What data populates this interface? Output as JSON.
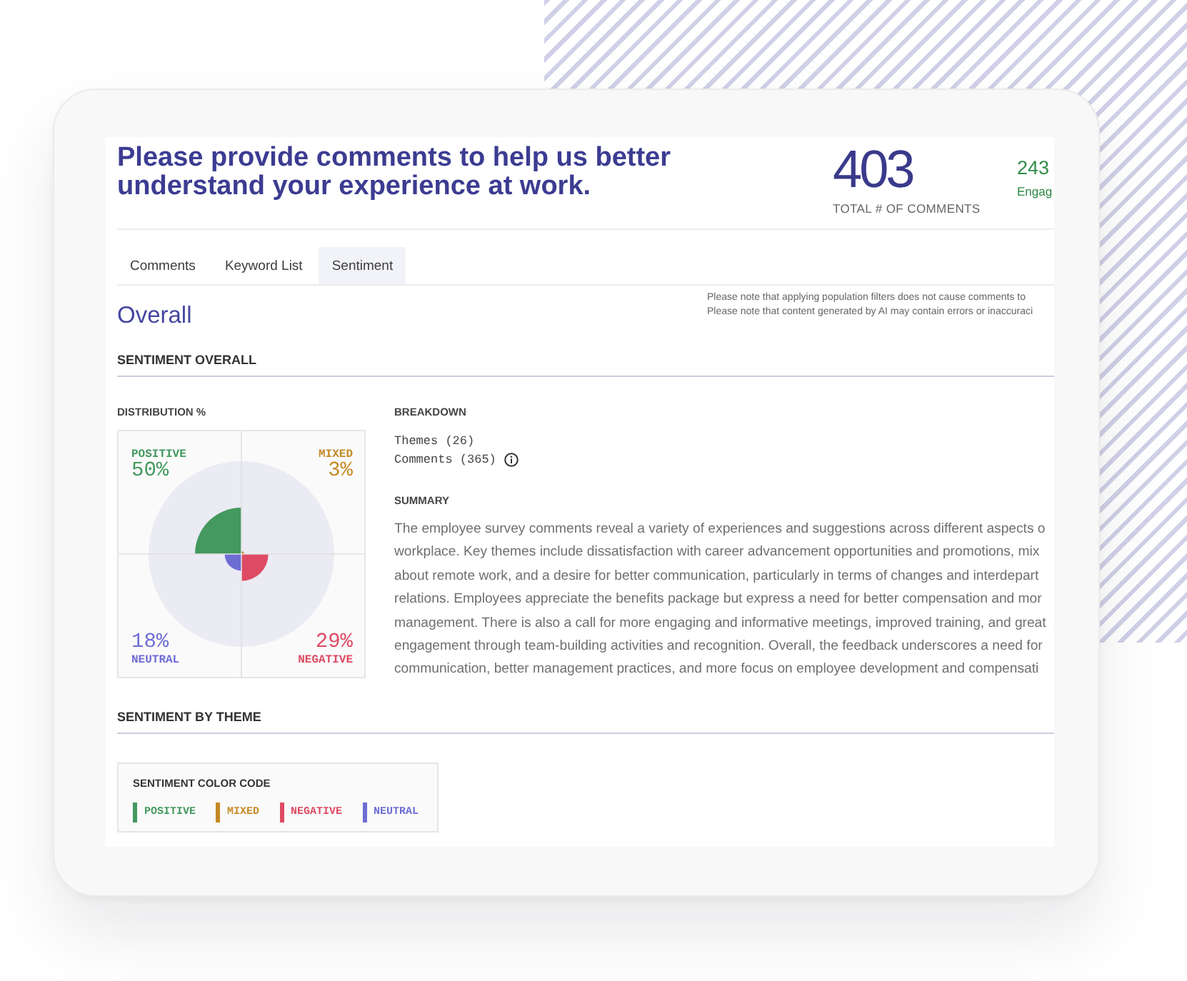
{
  "header": {
    "title": "Please provide comments to help us better understand your experience at work.",
    "stats": [
      {
        "kind": "total",
        "value": "403",
        "label": "TOTAL # OF COMMENTS",
        "color": "#3a3a8c"
      },
      {
        "kind": "partial",
        "value": "243",
        "label": "Engag",
        "color": "#2e8b47"
      }
    ]
  },
  "tabs": [
    {
      "label": "Comments",
      "selected": false
    },
    {
      "label": "Keyword List",
      "selected": false
    },
    {
      "label": "Sentiment",
      "selected": true
    }
  ],
  "page_title": "Overall",
  "notes": [
    "Please note that applying population filters does not cause comments to",
    "Please note that content generated by AI may contain errors or inaccuraci"
  ],
  "sentiment_overall": {
    "heading": "SENTIMENT OVERALL",
    "distribution": {
      "label": "DISTRIBUTION %",
      "items": [
        {
          "label": "POSITIVE",
          "percent": "50%",
          "level": 0.5,
          "color": "#43995f"
        },
        {
          "label": "MIXED",
          "percent": "3%",
          "level": 0.03,
          "color": "#c58a26"
        },
        {
          "label": "NEUTRAL",
          "percent": "18%",
          "level": 0.18,
          "color": "#6d6dd4"
        },
        {
          "label": "NEGATIVE",
          "percent": "29%",
          "level": 0.29,
          "color": "#de4a63"
        }
      ]
    },
    "breakdown": {
      "label": "BREAKDOWN",
      "items": [
        {
          "text": "Themes (26)",
          "info": false
        },
        {
          "text": "Comments (365)",
          "info": true
        }
      ]
    },
    "summary": {
      "label": "SUMMARY",
      "lines": [
        "The employee survey comments reveal a variety of experiences and suggestions across different aspects o",
        "workplace. Key themes include dissatisfaction with career advancement opportunities and promotions, mix",
        "about remote work, and a desire for better communication, particularly in terms of changes and interdepart",
        "relations. Employees appreciate the benefits package but express a need for better compensation and mor",
        "management. There is also a call for more engaging and informative meetings, improved training, and great",
        "engagement through team-building activities and recognition. Overall, the feedback underscores a need for",
        "communication, better management practices, and more focus on employee development and compensati"
      ]
    }
  },
  "sentiment_by_theme": {
    "heading": "SENTIMENT BY THEME",
    "legend": {
      "title": "SENTIMENT COLOR CODE",
      "items": [
        {
          "label": "POSITIVE",
          "color": "#43995f"
        },
        {
          "label": "MIXED",
          "color": "#c58a26"
        },
        {
          "label": "NEGATIVE",
          "color": "#de4a63"
        },
        {
          "label": "NEUTRAL",
          "color": "#6d6dd4"
        }
      ]
    }
  }
}
